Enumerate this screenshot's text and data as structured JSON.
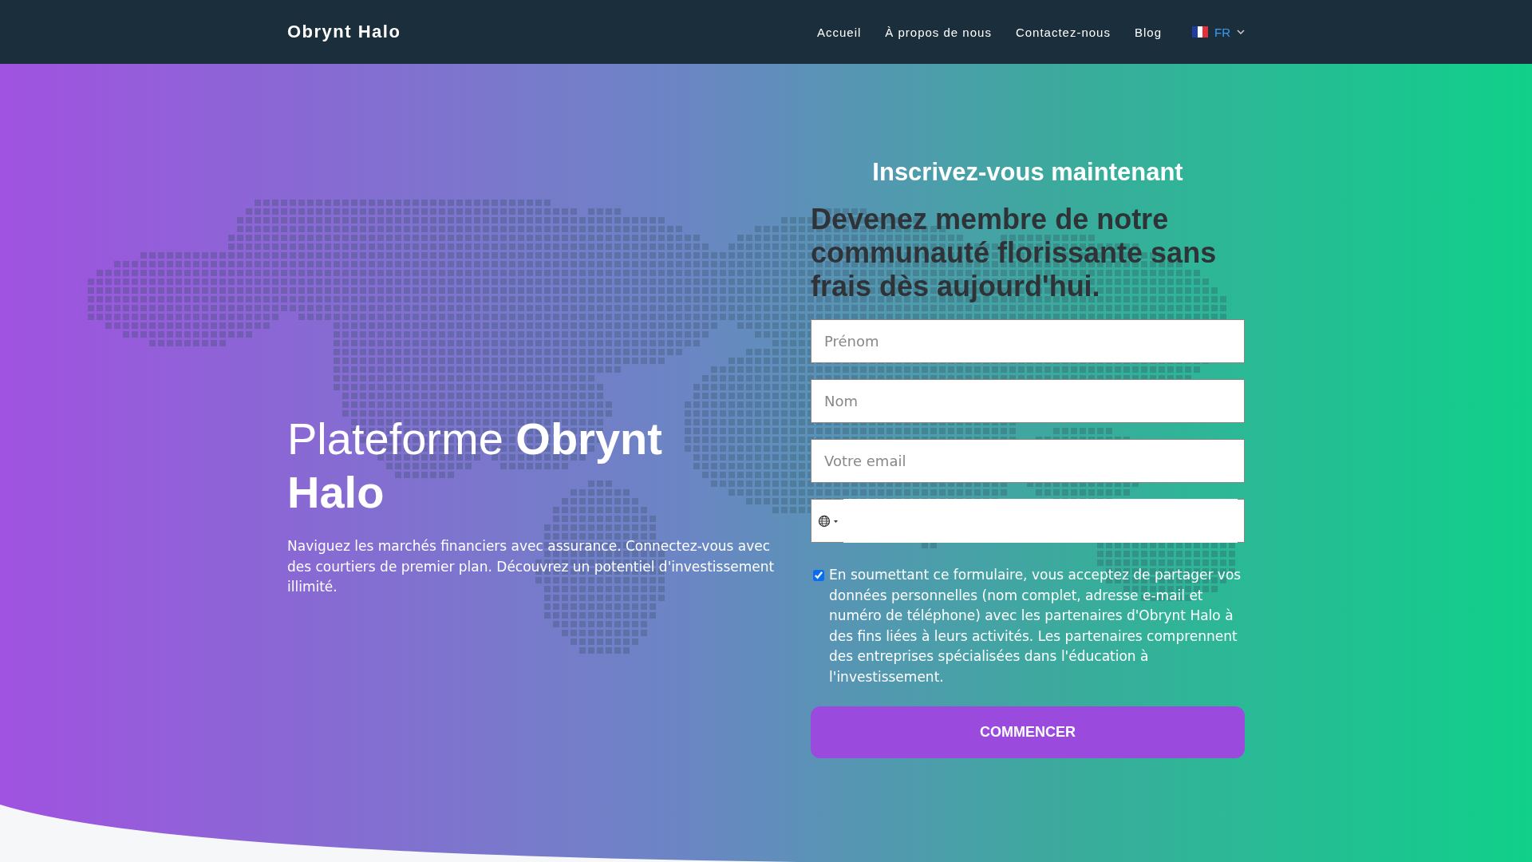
{
  "brand": "Obrynt Halo",
  "nav": [
    "Accueil",
    "À propos de nous",
    "Contactez-nous",
    "Blog"
  ],
  "language": {
    "code": "FR"
  },
  "hero": {
    "title": "Plateforme **Obrynt Halo**",
    "text": "Naviguez les marchés financiers avec assurance. Connectez-vous avec des courtiers de premier plan. Découvrez un potentiel d'investissement illimité."
  },
  "form": {
    "title": "Inscrivez-vous maintenant",
    "subtitle": "Devenez membre de notre communauté florissante sans frais dès aujourd'hui.",
    "fields": [
      {
        "kind": "text",
        "placeholder": "Prénom"
      },
      {
        "kind": "text",
        "placeholder": "Nom"
      },
      {
        "kind": "text",
        "placeholder": "Votre email"
      },
      {
        "kind": "phone"
      }
    ],
    "consent": {
      "checked": true,
      "text": "En soumettant ce formulaire, vous acceptez de partager vos données personnelles (nom complet, adresse e-mail et numéro de téléphone) avec les partenaires d'Obrynt Halo à des fins liées à leurs activités. Les partenaires comprennent des entreprises spécialisées dans l'éducation à l'investissement."
    },
    "button": "COMMENCER"
  }
}
